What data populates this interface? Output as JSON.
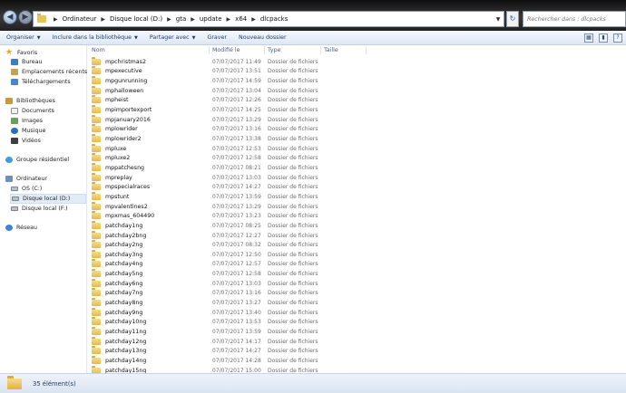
{
  "address": {
    "crumbs": [
      "Ordinateur",
      "Disque local (D:)",
      "gta",
      "update",
      "x64",
      "dlcpacks"
    ],
    "search_placeholder": "Rechercher dans : dlcpacks"
  },
  "toolbar": {
    "organize": "Organiser",
    "include_library": "Inclure dans la bibliothèque",
    "share_with": "Partager avec",
    "burn": "Graver",
    "new_folder": "Nouveau dossier"
  },
  "sidebar": {
    "favorites": "Favoris",
    "desktop": "Bureau",
    "recent": "Emplacements récents",
    "downloads": "Téléchargements",
    "libraries": "Bibliothèques",
    "documents": "Documents",
    "images": "Images",
    "music": "Musique",
    "videos": "Vidéos",
    "homegroup": "Groupe résidentiel",
    "computer": "Ordinateur",
    "drive_c": "OS (C:)",
    "drive_d": "Disque local (D:)",
    "drive_f": "Disque local (F:)",
    "network": "Réseau"
  },
  "columns": {
    "name": "Nom",
    "modified": "Modifié le",
    "type": "Type",
    "size": "Taille"
  },
  "files": [
    {
      "name": "mpchristmas2",
      "date": "07/07/2017 11:49",
      "type": "Dossier de fichiers"
    },
    {
      "name": "mpexecutive",
      "date": "07/07/2017 13:51",
      "type": "Dossier de fichiers"
    },
    {
      "name": "mpgunrunning",
      "date": "07/07/2017 14:59",
      "type": "Dossier de fichiers"
    },
    {
      "name": "mphalloween",
      "date": "07/07/2017 13:04",
      "type": "Dossier de fichiers"
    },
    {
      "name": "mpheist",
      "date": "07/07/2017 12:26",
      "type": "Dossier de fichiers"
    },
    {
      "name": "mpimportexport",
      "date": "07/07/2017 14:25",
      "type": "Dossier de fichiers"
    },
    {
      "name": "mpjanuary2016",
      "date": "07/07/2017 13:29",
      "type": "Dossier de fichiers"
    },
    {
      "name": "mplowrider",
      "date": "07/07/2017 13:16",
      "type": "Dossier de fichiers"
    },
    {
      "name": "mplowrider2",
      "date": "07/07/2017 13:38",
      "type": "Dossier de fichiers"
    },
    {
      "name": "mpluxe",
      "date": "07/07/2017 12:53",
      "type": "Dossier de fichiers"
    },
    {
      "name": "mpluxe2",
      "date": "07/07/2017 12:58",
      "type": "Dossier de fichiers"
    },
    {
      "name": "mppatchesng",
      "date": "07/07/2017 08:21",
      "type": "Dossier de fichiers"
    },
    {
      "name": "mpreplay",
      "date": "07/07/2017 13:03",
      "type": "Dossier de fichiers"
    },
    {
      "name": "mpspecialraces",
      "date": "07/07/2017 14:27",
      "type": "Dossier de fichiers"
    },
    {
      "name": "mpstunt",
      "date": "07/07/2017 13:59",
      "type": "Dossier de fichiers"
    },
    {
      "name": "mpvalentines2",
      "date": "07/07/2017 13:29",
      "type": "Dossier de fichiers"
    },
    {
      "name": "mpxmas_604490",
      "date": "07/07/2017 13:23",
      "type": "Dossier de fichiers"
    },
    {
      "name": "patchday1ng",
      "date": "07/07/2017 08:25",
      "type": "Dossier de fichiers"
    },
    {
      "name": "patchday2bng",
      "date": "07/07/2017 12:27",
      "type": "Dossier de fichiers"
    },
    {
      "name": "patchday2ng",
      "date": "07/07/2017 08:32",
      "type": "Dossier de fichiers"
    },
    {
      "name": "patchday3ng",
      "date": "07/07/2017 12:50",
      "type": "Dossier de fichiers"
    },
    {
      "name": "patchday4ng",
      "date": "07/07/2017 12:57",
      "type": "Dossier de fichiers"
    },
    {
      "name": "patchday5ng",
      "date": "07/07/2017 12:58",
      "type": "Dossier de fichiers"
    },
    {
      "name": "patchday6ng",
      "date": "07/07/2017 13:03",
      "type": "Dossier de fichiers"
    },
    {
      "name": "patchday7ng",
      "date": "07/07/2017 13:16",
      "type": "Dossier de fichiers"
    },
    {
      "name": "patchday8ng",
      "date": "07/07/2017 13:27",
      "type": "Dossier de fichiers"
    },
    {
      "name": "patchday9ng",
      "date": "07/07/2017 13:40",
      "type": "Dossier de fichiers"
    },
    {
      "name": "patchday10ng",
      "date": "07/07/2017 13:53",
      "type": "Dossier de fichiers"
    },
    {
      "name": "patchday11ng",
      "date": "07/07/2017 13:59",
      "type": "Dossier de fichiers"
    },
    {
      "name": "patchday12ng",
      "date": "07/07/2017 14:17",
      "type": "Dossier de fichiers"
    },
    {
      "name": "patchday13ng",
      "date": "07/07/2017 14:27",
      "type": "Dossier de fichiers"
    },
    {
      "name": "patchday14ng",
      "date": "07/07/2017 14:28",
      "type": "Dossier de fichiers"
    },
    {
      "name": "patchday15ng",
      "date": "07/07/2017 15:00",
      "type": "Dossier de fichiers"
    }
  ],
  "status": {
    "count": "35 élément(s)"
  }
}
